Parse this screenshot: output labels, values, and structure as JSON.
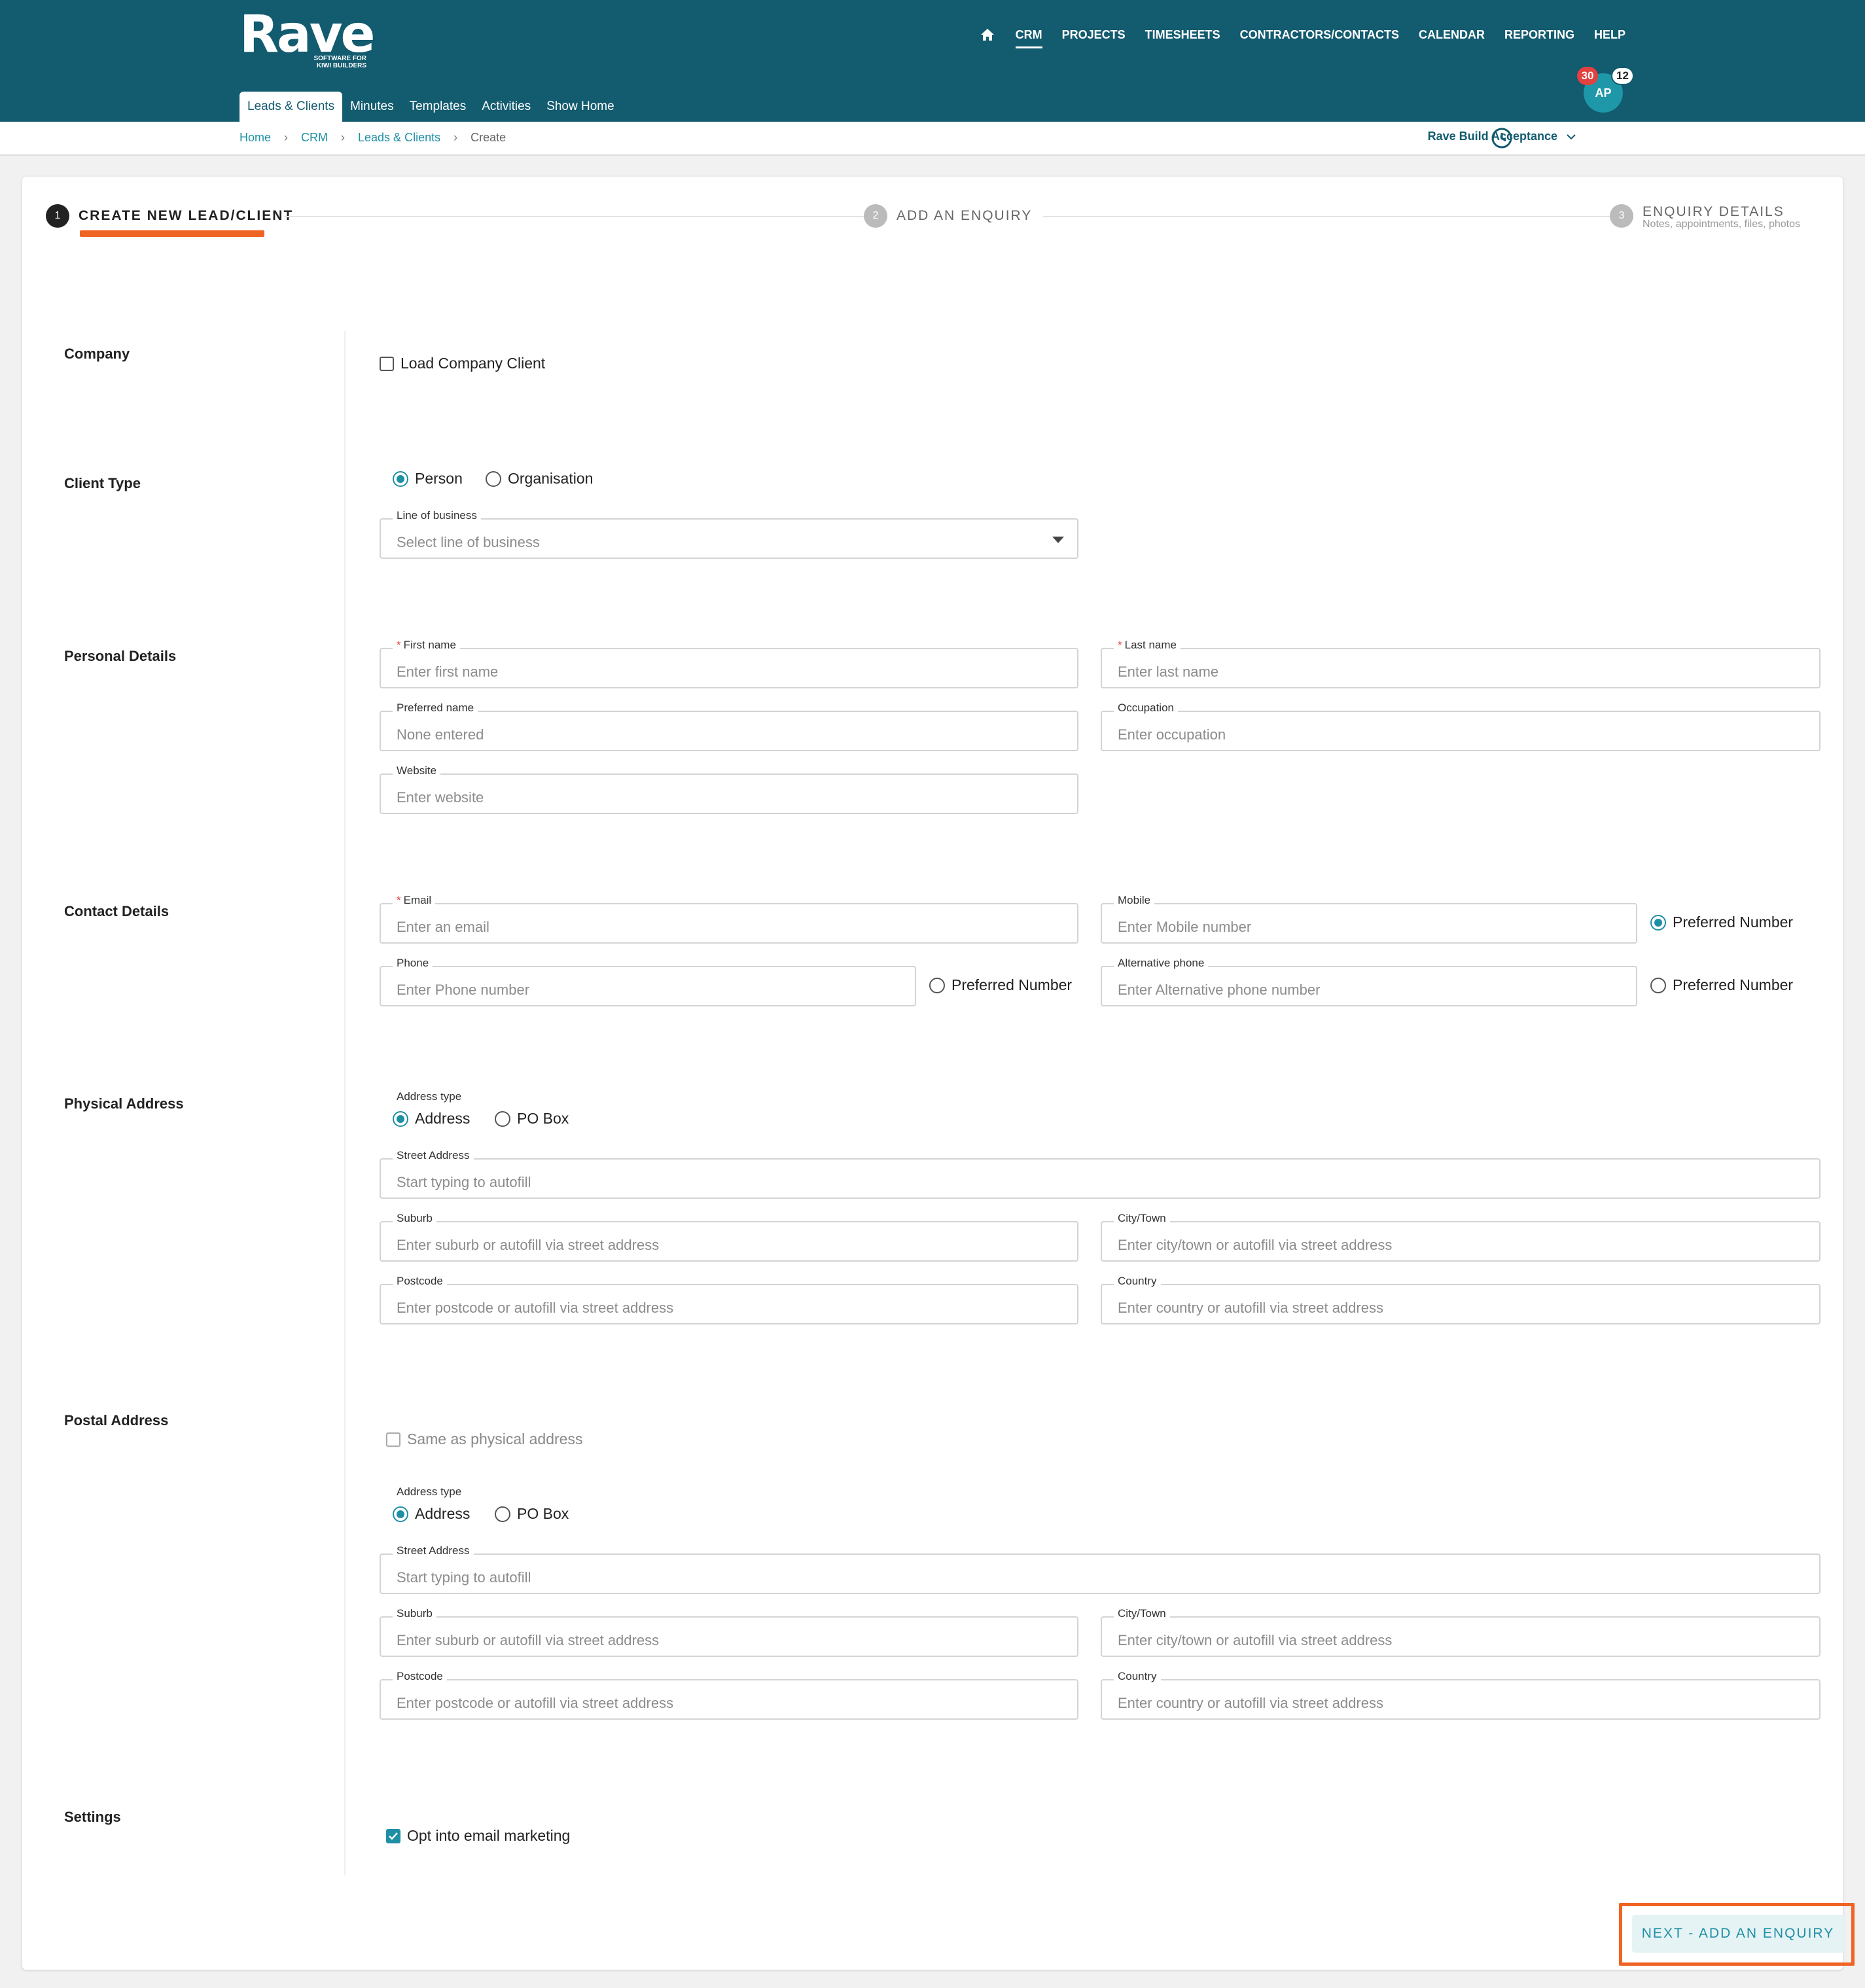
{
  "brand": {
    "name": "Rave",
    "tagline": "SOFTWARE FOR KIWI BUILDERS"
  },
  "nav": {
    "items": [
      "CRM",
      "PROJECTS",
      "TIMESHEETS",
      "CONTRACTORS/CONTACTS",
      "CALENDAR",
      "REPORTING",
      "HELP"
    ],
    "active": "CRM"
  },
  "subtabs": [
    "Leads & Clients",
    "Minutes",
    "Templates",
    "Activities",
    "Show Home"
  ],
  "user": {
    "initials": "AP",
    "notifications": "30",
    "messages": "12"
  },
  "breadcrumb": [
    "Home",
    "CRM",
    "Leads & Clients",
    "Create"
  ],
  "org": "Rave Build Acceptance",
  "steps": [
    {
      "num": "1",
      "label": "CREATE NEW LEAD/CLIENT"
    },
    {
      "num": "2",
      "label": "ADD AN ENQUIRY"
    },
    {
      "num": "3",
      "label": "ENQUIRY DETAILS",
      "sub": "Notes, appointments, files, photos"
    }
  ],
  "sections": {
    "company": "Company",
    "client_type": "Client Type",
    "personal": "Personal Details",
    "contact": "Contact Details",
    "physical": "Physical Address",
    "postal": "Postal Address",
    "settings": "Settings"
  },
  "company": {
    "load_label": "Load Company Client"
  },
  "client_type": {
    "person": "Person",
    "organisation": "Organisation",
    "selected": "Person",
    "lob_label": "Line of business",
    "lob_placeholder": "Select line of business"
  },
  "personal": {
    "first_name": {
      "label": "First name",
      "placeholder": "Enter first name"
    },
    "last_name": {
      "label": "Last name",
      "placeholder": "Enter last name"
    },
    "preferred_name": {
      "label": "Preferred name",
      "placeholder": "None entered"
    },
    "occupation": {
      "label": "Occupation",
      "placeholder": "Enter occupation"
    },
    "website": {
      "label": "Website",
      "placeholder": "Enter website"
    }
  },
  "contact": {
    "email": {
      "label": "Email",
      "placeholder": "Enter an email"
    },
    "mobile": {
      "label": "Mobile",
      "placeholder": "Enter Mobile number"
    },
    "phone": {
      "label": "Phone",
      "placeholder": "Enter Phone number"
    },
    "alt_phone": {
      "label": "Alternative phone",
      "placeholder": "Enter Alternative phone number"
    },
    "preferred": "Preferred Number",
    "preferred_selected": "mobile"
  },
  "address": {
    "type_label": "Address type",
    "address": "Address",
    "po_box": "PO Box",
    "street": {
      "label": "Street Address",
      "placeholder": "Start typing to autofill"
    },
    "suburb": {
      "label": "Suburb",
      "placeholder": "Enter suburb or autofill via street address"
    },
    "city": {
      "label": "City/Town",
      "placeholder": "Enter city/town or autofill via street address"
    },
    "postcode": {
      "label": "Postcode",
      "placeholder": "Enter postcode or autofill via street address"
    },
    "country": {
      "label": "Country",
      "placeholder": "Enter country or autofill via street address"
    }
  },
  "postal": {
    "same_as": "Same as physical address"
  },
  "settings": {
    "opt_in": "Opt into email marketing",
    "opt_in_checked": true
  },
  "actions": {
    "next": "NEXT - ADD AN ENQUIRY"
  },
  "colors": {
    "header": "#135b6f",
    "accent": "#1e8fa5",
    "highlight": "#f06423",
    "badge_red": "#e34040"
  }
}
